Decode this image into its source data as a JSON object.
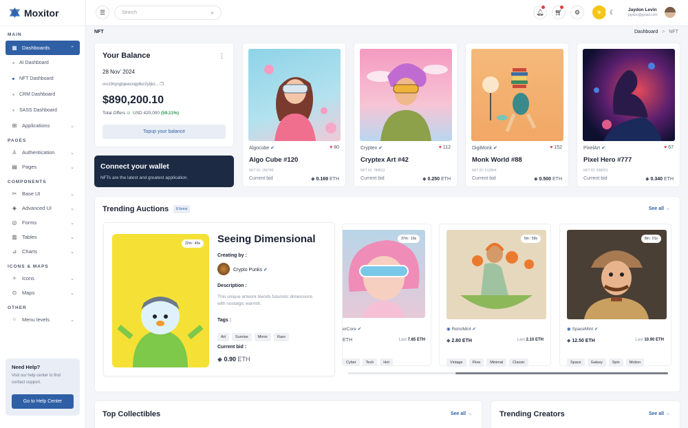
{
  "brand": "Moxitor",
  "sidebar": {
    "main": "MAIN",
    "dashboards": "Dashboards",
    "subs": [
      "AI Dashboard",
      "NFT Dashboard",
      "CRM Dashboard",
      "SASS Dashboard"
    ],
    "applications": "Applications",
    "pages_h": "PAGES",
    "authentication": "Authentication",
    "pages": "Pages",
    "components_h": "COMPONENTS",
    "base_ui": "Base UI",
    "advanced_ui": "Advanced UI",
    "forms": "Forms",
    "tables": "Tables",
    "charts": "Charts",
    "icons_h": "ICONS & MAPS",
    "icons": "Icons",
    "maps": "Maps",
    "other_h": "OTHER",
    "menu_levels": "Menu levels",
    "help": {
      "title": "Need Help?",
      "text": "Visit our help center to find contact support.",
      "button": "Go to Help Center"
    }
  },
  "header": {
    "search_placeholder": "Search",
    "user_name": "Jaydon Levin",
    "user_email": "jaydon@gmail.com"
  },
  "page": {
    "title": "NFT",
    "crumb_home": "Dashboard",
    "crumb_sep": ">",
    "crumb_current": "NFT"
  },
  "balance": {
    "title": "Your Balance",
    "date": "28 Nov' 2024",
    "address": "cro19rqngtqewcnqp6ur2ytjkz...",
    "amount": "$890,200.10",
    "offers_label": "Total Offers",
    "offers_value": "USD 420,000",
    "offers_change": "(59,11%)",
    "button": "Topup your balance"
  },
  "wallet": {
    "title": "Connect your wallet",
    "text": "NFTs are the latest and greatest application."
  },
  "nfts": [
    {
      "creator": "Algocube",
      "likes": "80",
      "title": "Algo Cube #120",
      "nftid": "NFT ID: 156745",
      "bid_label": "Current bid",
      "bid": "0.169",
      "unit": "ETH"
    },
    {
      "creator": "Cryptex",
      "likes": "112",
      "title": "Cryptex Art #42",
      "nftid": "NFT ID: 784512",
      "bid_label": "Current bid",
      "bid": "0.250",
      "unit": "ETH"
    },
    {
      "creator": "DigiMonk",
      "likes": "152",
      "title": "Monk World #88",
      "nftid": "NFT ID: 612804",
      "bid_label": "Current bid",
      "bid": "0.500",
      "unit": "ETH"
    },
    {
      "creator": "PixelArt",
      "likes": "67",
      "title": "Pixel Hero #777",
      "nftid": "NFT ID: 998201",
      "bid_label": "Current bid",
      "bid": "0.340",
      "unit": "ETH"
    }
  ],
  "auctions": {
    "title": "Trending Auctions",
    "badge": "8 Items",
    "see_all": "See all",
    "featured": {
      "timer": "22m : 45s",
      "title": "Seeing Dimensional",
      "creating_by": "Creating by :",
      "creator": "Crypto Punks",
      "desc_label": "Description :",
      "desc": "This unique artwork blends futuristic dimensions with nostalgic warmth.",
      "tags_label": "Tags :",
      "tags": [
        "Art",
        "Sunrise",
        "Mirror",
        "Rare"
      ],
      "bid_label": "Current bid :",
      "bid": "0.90",
      "unit": "ETH"
    },
    "items": [
      {
        "timer": "37m : 10s",
        "creator": "erCore",
        "bid": "ETH",
        "last_label": "Last",
        "last": "7.85 ETH",
        "tags": [
          "Cyber",
          "Tech",
          "Hot"
        ]
      },
      {
        "timer": "5m : 59s",
        "creator": "RetroMint",
        "bid": "2.80 ETH",
        "last_label": "Last",
        "last": "2.10 ETH",
        "tags": [
          "Vintage",
          "Flow",
          "Minimal",
          "Classic"
        ]
      },
      {
        "timer": "8m : 01s",
        "creator": "SpaceMint",
        "bid": "12.50 ETH",
        "last_label": "Last",
        "last": "10.90 ETH",
        "tags": [
          "Space",
          "Galaxy",
          "Spin",
          "Motion"
        ]
      }
    ]
  },
  "collectibles": {
    "title": "Top Collectibles",
    "see_all": "See all"
  },
  "creators": {
    "title": "Trending Creators",
    "see_all": "See all"
  }
}
